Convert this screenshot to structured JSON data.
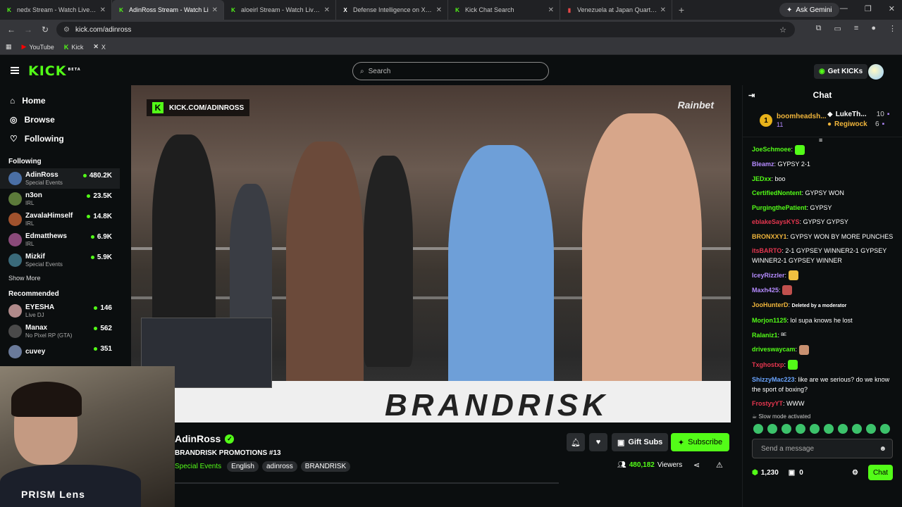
{
  "browser": {
    "tabs": [
      {
        "title": "nedx Stream - Watch Live on Ki",
        "icon": "kick-icon",
        "fav": "K",
        "fav_color": "#53fc18",
        "active": false
      },
      {
        "title": "AdinRoss Stream - Watch Li",
        "icon": "kick-icon",
        "fav": "K",
        "fav_color": "#53fc18",
        "active": true
      },
      {
        "title": "aloeirl Stream - Watch Live on K",
        "icon": "kick-icon",
        "fav": "K",
        "fav_color": "#53fc18",
        "active": false
      },
      {
        "title": "Defense Intelligence on X: \"Bu",
        "icon": "x-icon",
        "fav": "X",
        "fav_color": "#ffffff",
        "active": false
      },
      {
        "title": "Kick Chat Search",
        "icon": "kick-icon",
        "fav": "K",
        "fav_color": "#53fc18",
        "active": false
      },
      {
        "title": "Venezuela at Japan Quarterfin",
        "icon": "flag-icon",
        "fav": "▮",
        "fav_color": "#e54848",
        "active": false
      }
    ],
    "ask_gemini": "Ask Gemini",
    "url": "kick.com/adinross",
    "bookmarks": [
      {
        "label": "YouTube",
        "icon": "youtube-icon"
      },
      {
        "label": "Kick",
        "icon": "kick-icon"
      },
      {
        "label": "X",
        "icon": "x-icon"
      }
    ]
  },
  "header": {
    "logo": "KICK",
    "logo_sup": "BETA",
    "search_placeholder": "Search",
    "get_kicks": "Get KICKs"
  },
  "sidebar": {
    "nav": [
      {
        "label": "Home",
        "icon": "home-icon"
      },
      {
        "label": "Browse",
        "icon": "compass-icon"
      },
      {
        "label": "Following",
        "icon": "heart-icon"
      }
    ],
    "following_title": "Following",
    "following": [
      {
        "name": "AdinRoss",
        "category": "Special Events",
        "viewers": "480.2K",
        "color": "#4a6fa5"
      },
      {
        "name": "n3on",
        "category": "IRL",
        "viewers": "23.5K",
        "color": "#5c7a3a"
      },
      {
        "name": "ZavalaHimself",
        "category": "IRL",
        "viewers": "14.8K",
        "color": "#a0522d"
      },
      {
        "name": "Edmatthews",
        "category": "IRL",
        "viewers": "6.9K",
        "color": "#8a4a7a"
      },
      {
        "name": "Mizkif",
        "category": "Special Events",
        "viewers": "5.9K",
        "color": "#3a6a7a"
      }
    ],
    "show_more": "Show More",
    "recommended_title": "Recommended",
    "recommended": [
      {
        "name": "EYESHA",
        "category": "Live DJ",
        "viewers": "146",
        "color": "#b08a8a"
      },
      {
        "name": "Manax",
        "category": "No Pixel RP (GTA)",
        "viewers": "562",
        "color": "#4a4a4a"
      },
      {
        "name": "cuvey",
        "category": "",
        "viewers": "351",
        "color": "#6a7a9a"
      }
    ]
  },
  "video": {
    "overlay_url": "KICK.COM/ADINROSS",
    "sponsor": "Rainbet",
    "ring_text": "BRANDRISK"
  },
  "webcam": {
    "label": "PRISM Lens"
  },
  "stream": {
    "streamer": "AdinRoss",
    "title": "BRANDRISK PROMOTIONS #13",
    "category": "Special Events",
    "tags": [
      "English",
      "adinross",
      "BRANDRISK"
    ],
    "gift_subs": "Gift Subs",
    "subscribe": "Subscribe",
    "viewers": "480,182",
    "viewers_label": "Viewers"
  },
  "chat": {
    "title": "Chat",
    "top_gifter": {
      "name": "boomheadsh...",
      "count": "11",
      "rank": "1"
    },
    "gifters": [
      {
        "name": "LukeTh...",
        "count": "10",
        "color": "#ffffff"
      },
      {
        "name": "Regiwock",
        "count": "6",
        "color": "#f0b53b"
      }
    ],
    "messages": [
      {
        "user": "JoeSchmoee",
        "text": "",
        "color": "#53fc18",
        "emote": "#53fc18"
      },
      {
        "user": "Bleamz",
        "text": "GYPSY 2-1",
        "color": "#b58bff"
      },
      {
        "user": "JEDxx",
        "text": "boo",
        "color": "#53fc18"
      },
      {
        "user": "CertifiedNontent",
        "text": "GYPSY WON",
        "color": "#53fc18"
      },
      {
        "user": "PurgingthePatient",
        "text": "GYPSY",
        "color": "#53fc18"
      },
      {
        "user": "eblakeSaysKYS",
        "text": "GYPSY GYPSY",
        "color": "#e5364f"
      },
      {
        "user": "BRONXXY1",
        "text": "GYPSY WON BY MORE PUNCHES",
        "color": "#f0b53b"
      },
      {
        "user": "itsBARTO",
        "text": "2-1 GYPSEY WINNER2-1 GYPSEY WINNER2-1 GYPSEY WINNER",
        "color": "#e5364f"
      },
      {
        "user": "IceyRizzler",
        "text": "",
        "color": "#b58bff",
        "emote": "#f0c040"
      },
      {
        "user": "Maxh425",
        "text": "",
        "color": "#b58bff",
        "emote": "#c0504d"
      },
      {
        "user": "JooHunterD",
        "text": "Deleted by a moderator",
        "color": "#f0b53b",
        "small": true
      },
      {
        "user": "Morjon1125",
        "text": "lol supa knows he lost",
        "color": "#53fc18"
      },
      {
        "user": "Ralaniz1",
        "text": "ᴮᴱ",
        "color": "#53fc18"
      },
      {
        "user": "driveswaycam",
        "text": "",
        "color": "#53fc18",
        "emote": "#c89070"
      },
      {
        "user": "Txghostxp",
        "text": "",
        "color": "#e5364f",
        "emote": "#53fc18"
      },
      {
        "user": "ShizzyMac223",
        "text": "like are we serious? do we know the sport of boxing?",
        "color": "#6aa5ff"
      },
      {
        "user": "FrostyyYT",
        "text": "WWW",
        "color": "#e5364f"
      }
    ],
    "slow_mode": "Slow mode activated",
    "input_placeholder": "Send a message",
    "points": "1,230",
    "gifts": "0",
    "send": "Chat"
  }
}
